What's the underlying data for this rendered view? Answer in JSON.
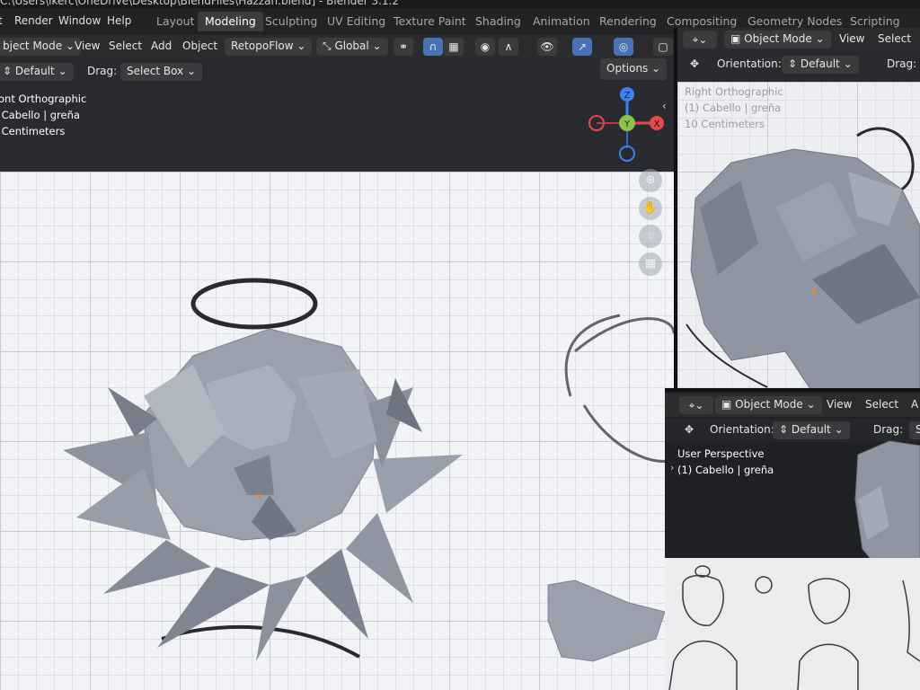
{
  "window": {
    "title": "C:\\Users\\ikerc\\OneDrive\\Desktop\\BlendFiles\\Hazzan.blend] - Blender 3.1.2"
  },
  "menu": {
    "render": "Render",
    "window": "Window",
    "help": "Help"
  },
  "workspaces": [
    "Layout",
    "Modeling",
    "Sculpting",
    "UV Editing",
    "Texture Paint",
    "Shading",
    "Animation",
    "Rendering",
    "Compositing",
    "Geometry Nodes",
    "Scripting"
  ],
  "active_workspace": "Modeling",
  "main_viewport": {
    "header": {
      "mode": "bject Mode",
      "view": "View",
      "select": "Select",
      "add": "Add",
      "object": "Object",
      "addon": "RetopoFlow",
      "transform": "Global"
    },
    "tool_header": {
      "orientation_value": "Default",
      "drag_label": "Drag:",
      "drag_value": "Select Box",
      "options": "Options"
    },
    "overlay": {
      "view_name": "ont Orthographic",
      "collection": "Cabello | greña",
      "scale": "Centimeters"
    },
    "gizmo": {
      "z": "Z",
      "y": "Y",
      "x": "X"
    }
  },
  "right_viewport": {
    "header": {
      "mode": "Object Mode",
      "view": "View",
      "select": "Select"
    },
    "tool_header": {
      "orientation_label": "Orientation:",
      "orientation_value": "Default",
      "drag_label": "Drag:"
    },
    "overlay": {
      "view_name": "Right Orthographic",
      "collection": "(1) Cabello | greña",
      "scale": "10 Centimeters"
    }
  },
  "bottom_viewport": {
    "header": {
      "mode": "Object Mode",
      "view": "View",
      "select": "Select",
      "extra": "A"
    },
    "tool_header": {
      "orientation_label": "Orientation:",
      "orientation_value": "Default",
      "drag_label": "Drag:",
      "drag_value": "S"
    },
    "overlay": {
      "view_name": "User Perspective",
      "collection": "(1) Cabello | greña"
    }
  },
  "colors": {
    "accent_blue": "#4772b3",
    "axis_x": "#e5484d",
    "axis_y": "#8bc34a",
    "axis_z": "#3b82f6",
    "mesh": "#9aa1ad",
    "sketch": "#2a2a2e"
  }
}
